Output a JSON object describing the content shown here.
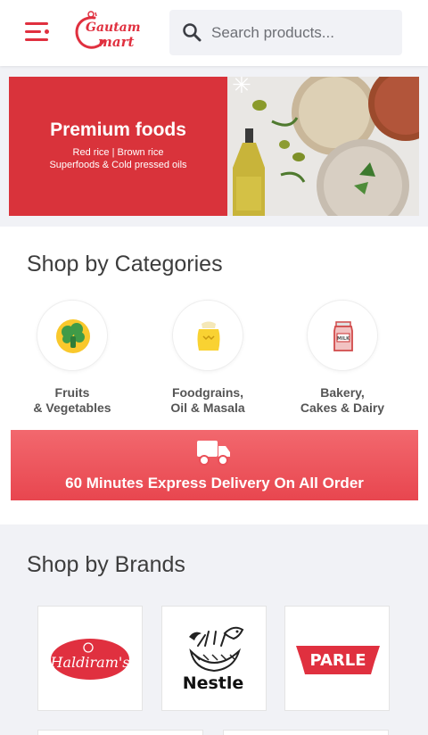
{
  "header": {
    "menu_icon": "hamburger-menu-icon",
    "logo_line1": "Gautam",
    "logo_line2": "mart",
    "search_placeholder": "Search products...",
    "search_icon": "search-icon",
    "brand_color": "#e0303f"
  },
  "banner": {
    "title": "Premium foods",
    "subtitle1": "Red rice | Brown rice",
    "subtitle2": "Superfoods & Cold pressed oils",
    "bg_color": "#d9333b"
  },
  "categories": {
    "title": "Shop by Categories",
    "items": [
      {
        "line1": "Fruits",
        "line2": "& Vegetables",
        "icon": "broccoli-icon"
      },
      {
        "line1": "Foodgrains,",
        "line2": "Oil & Masala",
        "icon": "grain-sack-icon"
      },
      {
        "line1": "Bakery,",
        "line2": "Cakes & Dairy",
        "icon": "milk-carton-icon"
      }
    ]
  },
  "delivery": {
    "text": "60 Minutes Express Delivery On All Order",
    "icon": "delivery-truck-icon"
  },
  "brands": {
    "title": "Shop by Brands",
    "items": [
      {
        "name": "Haldiram's"
      },
      {
        "name": "Nestle"
      },
      {
        "name": "PARLE"
      }
    ]
  }
}
